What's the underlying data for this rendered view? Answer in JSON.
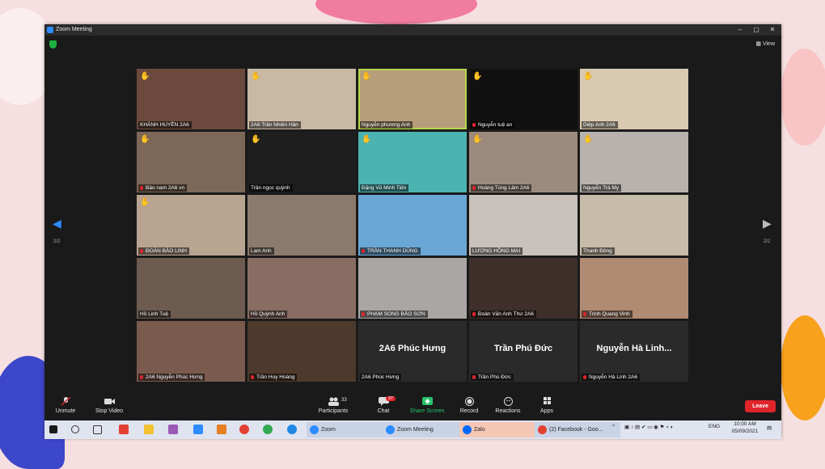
{
  "window": {
    "title": "Zoom Meeting",
    "view_label": "View",
    "minimize": "–",
    "maximize": "▢",
    "close": "✕"
  },
  "page_indicator": {
    "left": "2/2",
    "right": "2/2"
  },
  "tiles": [
    {
      "name": "KHÁNH HUYỀN 2A6",
      "hand": true,
      "muted": false,
      "color": "#6b4a3d"
    },
    {
      "name": "2A6 Trần Nhiên Hân",
      "hand": true,
      "muted": false,
      "color": "#c9b9a4"
    },
    {
      "name": "Nguyễn phương Anh",
      "hand": true,
      "muted": false,
      "color": "#b59e79",
      "active": true
    },
    {
      "name": "Nguyễn tuệ an",
      "hand": true,
      "muted": true,
      "color": "#111111"
    },
    {
      "name": "Diệp Anh 2A6",
      "hand": true,
      "muted": false,
      "color": "#d9c9b0"
    },
    {
      "name": "Bảo nam 2A6 vn",
      "hand": true,
      "muted": true,
      "color": "#7d6758"
    },
    {
      "name": "Trần ngọc quỳnh",
      "hand": true,
      "muted": false,
      "color": "#1e1e1e"
    },
    {
      "name": "Đặng Vũ Minh Tiến",
      "hand": true,
      "muted": false,
      "color": "#4bb3b0"
    },
    {
      "name": "Hoàng Tùng Lâm 2A6",
      "hand": true,
      "muted": true,
      "color": "#9c8b7d"
    },
    {
      "name": "Nguyễn Trà My",
      "hand": true,
      "muted": false,
      "color": "#b7b2ad"
    },
    {
      "name": "ĐOÀN BẢO LINH",
      "hand": true,
      "muted": true,
      "color": "#b9a391"
    },
    {
      "name": "Lam Anh",
      "hand": false,
      "muted": false,
      "color": "#8c7a6c"
    },
    {
      "name": "TRẦN THANH DŨNG",
      "hand": false,
      "muted": true,
      "color": "#6aa7d6"
    },
    {
      "name": "LƯƠNG HỒNG MAI",
      "hand": false,
      "muted": false,
      "color": "#c8c1bc"
    },
    {
      "name": "Thanh Đông",
      "hand": false,
      "muted": false,
      "color": "#c7bca8"
    },
    {
      "name": "Hồ Linh Tuệ",
      "hand": false,
      "muted": false,
      "color": "#6d5b50"
    },
    {
      "name": "Hồ Quỳnh Anh",
      "hand": false,
      "muted": false,
      "color": "#8a6d62"
    },
    {
      "name": "PHẠM SONG BẢO SƠN",
      "hand": false,
      "muted": true,
      "color": "#a9a6a4"
    },
    {
      "name": "Đoàn Văn Anh Thư 2A6",
      "hand": false,
      "muted": true,
      "color": "#3e2f2a"
    },
    {
      "name": "Trịnh Quang Vinh",
      "hand": false,
      "muted": true,
      "color": "#b08b73"
    },
    {
      "name": "2A6 Nguyễn Phúc Hưng",
      "hand": false,
      "muted": true,
      "color": "#7b5a4e"
    },
    {
      "name": "Trần Huy Hoàng",
      "hand": false,
      "muted": true,
      "color": "#4d3a2c"
    },
    {
      "name": "2A6 Phúc Hưng",
      "hand": false,
      "muted": false,
      "color": "#2a2a2a",
      "big": "2A6 Phúc Hưng"
    },
    {
      "name": "Trần Phú Đức",
      "hand": false,
      "muted": true,
      "color": "#2a2a2a",
      "big": "Trần Phú Đức"
    },
    {
      "name": "Nguyễn Hà Linh 2A6",
      "hand": false,
      "muted": true,
      "color": "#2a2a2a",
      "big": "Nguyễn Hà Linh..."
    }
  ],
  "toolbar": {
    "unmute": "Unmute",
    "stop_video": "Stop Video",
    "participants": "Participants",
    "participants_count": "33",
    "chat": "Chat",
    "chat_badge": "37",
    "share": "Share Screen",
    "record": "Record",
    "reactions": "Reactions",
    "apps": "Apps",
    "leave": "Leave"
  },
  "taskbar": {
    "apps": [
      {
        "label": "Zoom",
        "color": "#2d8cff"
      },
      {
        "label": "Zoom Meeting",
        "color": "#2d8cff"
      },
      {
        "label": "Zalo",
        "color": "#0068ff"
      },
      {
        "label": "(2) Facebook - Goo...",
        "color": "#e34133"
      }
    ],
    "lang": "ENG",
    "time": "10:00 AM",
    "date": "05/09/2021"
  }
}
